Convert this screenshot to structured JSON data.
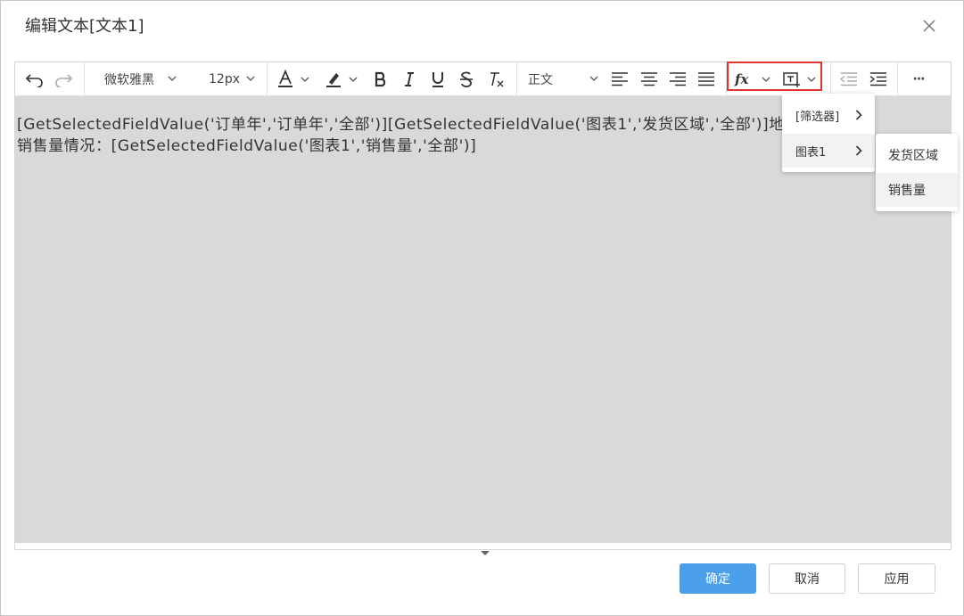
{
  "dialog": {
    "title": "编辑文本[文本1]"
  },
  "toolbar": {
    "font_family": "微软雅黑",
    "font_size": "12px",
    "paragraph_style": "正文",
    "more_label": "···"
  },
  "editor": {
    "line1": "[GetSelectedFieldValue('订单年','订单年','全部')][GetSelectedFieldValue('图表1','发货区域','全部')]地区的",
    "line2": "销售量情况：[GetSelectedFieldValue('图表1','销售量','全部')]"
  },
  "menus": {
    "level1": [
      {
        "label": "[筛选器]"
      },
      {
        "label": "图表1"
      }
    ],
    "level2": [
      {
        "label": "发货区域"
      },
      {
        "label": "销售量"
      }
    ]
  },
  "footer": {
    "confirm_label": "确定",
    "cancel_label": "取消",
    "apply_label": "应用"
  },
  "colors": {
    "primary": "#4a9fe8",
    "highlight_border": "#e0342e",
    "editor_background": "#d9d9d9"
  }
}
